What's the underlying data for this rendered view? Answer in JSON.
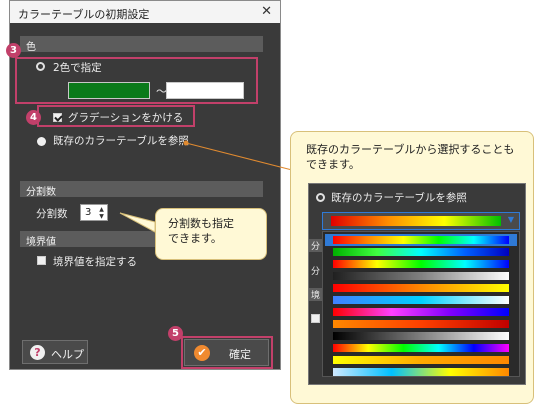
{
  "dialog": {
    "title": "カラーテーブルの初期設定",
    "close_glyph": "✕"
  },
  "color_section": {
    "header": "色",
    "two_color_label": "2色で指定",
    "swatch_from_color": "#0a7a1a",
    "swatch_to_color": "#ffffff",
    "range_separator": "～",
    "gradation_label": "グラデーションをかける",
    "gradation_checked": true,
    "existing_table_label": "既存のカラーテーブルを参照",
    "selected_option": "existing_table"
  },
  "divisions_section": {
    "header": "分割数",
    "label": "分割数",
    "value": "3"
  },
  "boundary_section": {
    "header": "境界値",
    "checkbox_label": "境界値を指定する",
    "checked": false
  },
  "footer": {
    "help_label": "ヘルプ",
    "ok_label": "確定"
  },
  "badges": [
    "3",
    "4",
    "5"
  ],
  "callouts": {
    "divisions_note": [
      "分割数も指定",
      "できます。"
    ],
    "existing_table_note": [
      "既存のカラーテーブルから選択することも",
      "できます。"
    ]
  },
  "inset": {
    "radio_label": "既存のカラーテーブルを参照",
    "bg_fragments": [
      "分",
      "分",
      "境"
    ],
    "selected_gradient": [
      "#e00000",
      "#ff8c00",
      "#ffff00",
      "#00c000"
    ],
    "options": [
      [
        "#ff0000",
        "#ff8800",
        "#ffff00",
        "#00ff00",
        "#00ffff",
        "#0000ff"
      ],
      [
        "#00b000",
        "#40ff40",
        "#00ffff",
        "#0060ff",
        "#0000c0"
      ],
      [
        "#ff0000",
        "#ffff00",
        "#00ff00",
        "#00ffff",
        "#0000ff"
      ],
      [
        "#202020",
        "#808080",
        "#ffffff"
      ],
      [
        "#ff0000",
        "#ff8800",
        "#ffff00"
      ],
      [
        "#4080ff",
        "#00d0ff",
        "#ffffff"
      ],
      [
        "#ff0000",
        "#ff40ff",
        "#8000ff",
        "#0000ff"
      ],
      [
        "#ff8800",
        "#ff4000",
        "#c00000"
      ],
      [
        "#000000",
        "#ffffff"
      ],
      [
        "#ff0000",
        "#ffff00",
        "#00ff00",
        "#00ffff",
        "#0000ff",
        "#ff00ff"
      ],
      [
        "#ffff00",
        "#ffaa00",
        "#ff8800"
      ],
      [
        "#cfe8ff",
        "#00c0ff",
        "#ffff00",
        "#ff8800"
      ]
    ]
  }
}
